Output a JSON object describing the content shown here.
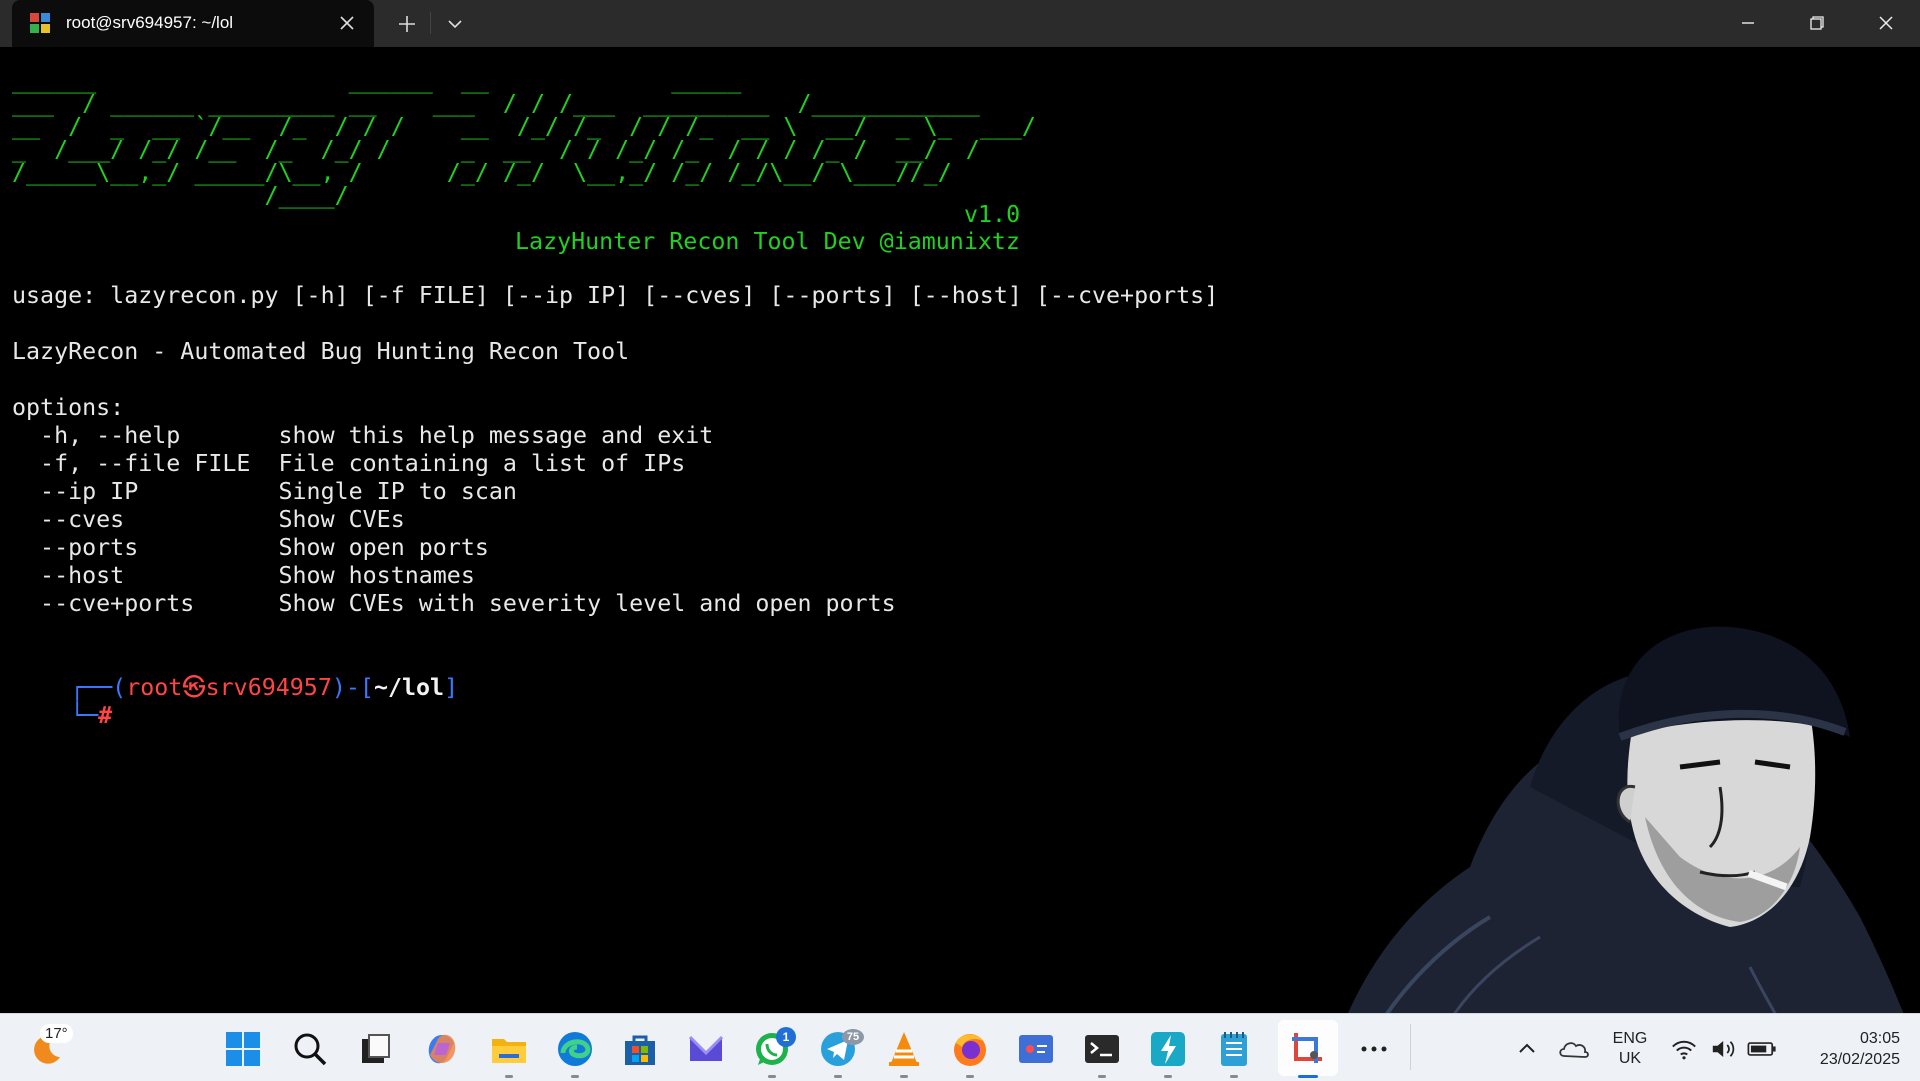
{
  "window": {
    "tab_title": "root@srv694957: ~/lol"
  },
  "terminal": {
    "banner": [
      "______                  ______  __             _____",
      "___  / ______ _________ __    ___  / / /___  _________  /____________",
      "__  /  _  __ `/__  /_  / / /    __  /_/ /_  / / /_  __ \\  __/  _ \\_  ___/",
      "_  /___/ /_/ /__  /_  /_/ /     _  __  / / /_/ /_  / / / /_ /  __/  /",
      "/_____\\__,_/ _____/\\__, /      /_/ /_/  \\__,_/ /_/ /_/\\__/ \\___//_/",
      "                  /____/"
    ],
    "version": "v1.0",
    "credit": "LazyHunter Recon Tool Dev @iamunixtz",
    "usage": "usage: lazyrecon.py [-h] [-f FILE] [--ip IP] [--cves] [--ports] [--host] [--cve+ports]",
    "description": "LazyRecon - Automated Bug Hunting Recon Tool",
    "options_header": "options:",
    "options": [
      {
        "flag": "  -h, --help       ",
        "desc": "show this help message and exit"
      },
      {
        "flag": "  -f, --file FILE  ",
        "desc": "File containing a list of IPs"
      },
      {
        "flag": "  --ip IP          ",
        "desc": "Single IP to scan"
      },
      {
        "flag": "  --cves           ",
        "desc": "Show CVEs"
      },
      {
        "flag": "  --ports          ",
        "desc": "Show open ports"
      },
      {
        "flag": "  --host           ",
        "desc": "Show hostnames"
      },
      {
        "flag": "  --cve+ports      ",
        "desc": "Show CVEs with severity level and open ports"
      }
    ],
    "prompt": {
      "corner_top": "┌──(",
      "user": "root",
      "at_symbol": "㉿",
      "host": "srv694957",
      "mid": ")-[",
      "path": "~/lol",
      "close": "]",
      "corner_bottom": "└─",
      "hash": "#"
    }
  },
  "taskbar": {
    "weather_temp": "17°",
    "whatsapp_badge": "1",
    "telegram_badge": "75",
    "lang_top": "ENG",
    "lang_bottom": "UK",
    "time": "03:05",
    "date": "23/02/2025",
    "icons": [
      "weather-icon",
      "windows-start-icon",
      "search-icon",
      "task-view-icon",
      "copilot-icon",
      "file-explorer-icon",
      "edge-icon",
      "microsoft-store-icon",
      "mail-icon",
      "whatsapp-icon",
      "telegram-icon",
      "vlc-icon",
      "firefox-icon",
      "screen-recorder-icon",
      "terminal-icon",
      "power-automate-icon",
      "notepad-icon",
      "snipping-tool-icon",
      "more-icon"
    ]
  },
  "colors": {
    "banner_green": "#1fd21f",
    "prompt_red": "#ff4545",
    "prompt_blue": "#3b78ff",
    "taskbar_bg": "#eef1f6",
    "titlebar_bg": "#2b2b2b"
  }
}
